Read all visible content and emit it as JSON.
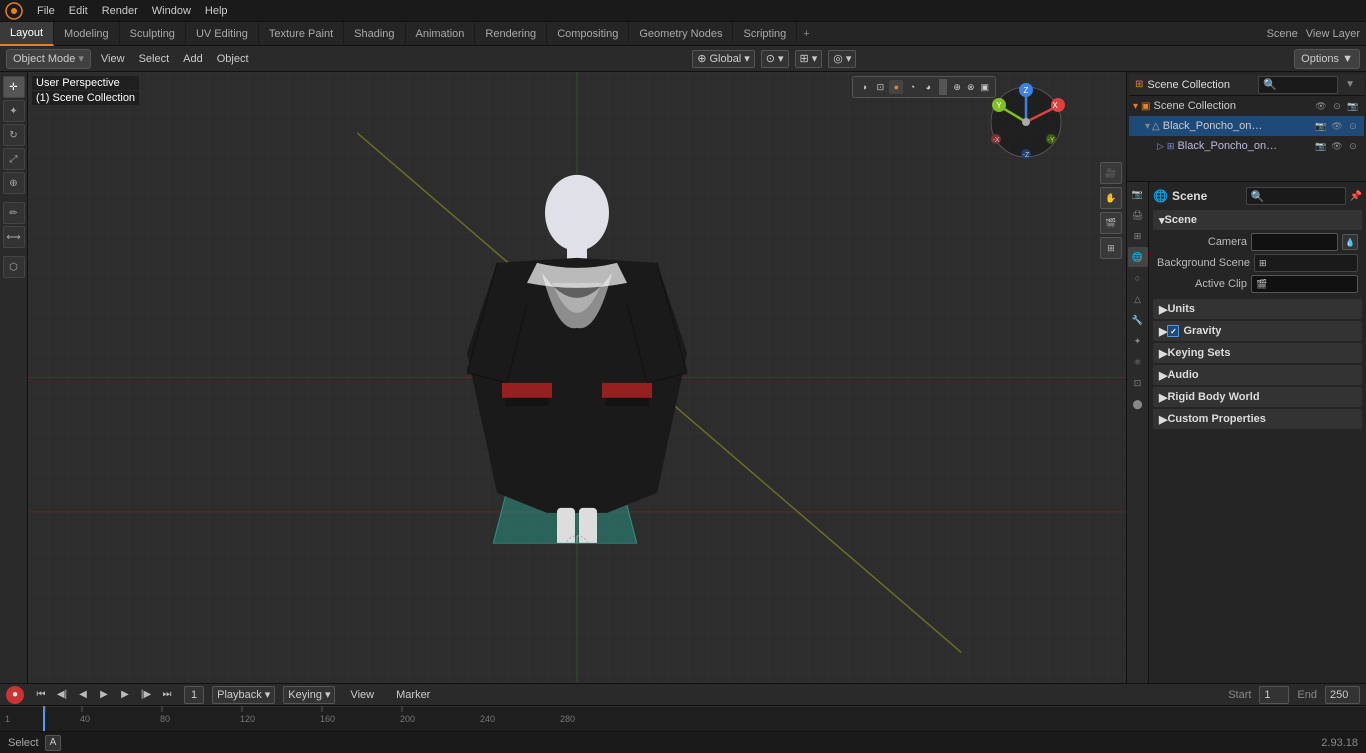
{
  "app": {
    "title": "Blender",
    "version": "2.93.18"
  },
  "menu": {
    "logo_symbol": "⬡",
    "items": [
      "File",
      "Edit",
      "Render",
      "Window",
      "Help"
    ]
  },
  "workspace_tabs": {
    "tabs": [
      "Layout",
      "Modeling",
      "Sculpting",
      "UV Editing",
      "Texture Paint",
      "Shading",
      "Animation",
      "Rendering",
      "Compositing",
      "Geometry Nodes",
      "Scripting"
    ],
    "active": "Layout",
    "add_symbol": "+"
  },
  "header": {
    "mode": "Object Mode",
    "view_label": "View",
    "select_label": "Select",
    "add_label": "Add",
    "object_label": "Object",
    "transform": "Global",
    "options_label": "Options ▼"
  },
  "viewport": {
    "view_type": "User Perspective",
    "scene_collection": "(1) Scene Collection"
  },
  "right_panel": {
    "header_title": "Scene Collection",
    "search_placeholder": "🔍",
    "filter_symbol": "▼"
  },
  "outliner": {
    "collection_label": "Scene Collection",
    "items": [
      {
        "name": "Black_Poncho_on_Mannequin",
        "indent": 1,
        "expanded": true,
        "icons": [
          "📷",
          "👁",
          "🔒"
        ]
      },
      {
        "name": "Black_Poncho_on_Manne",
        "indent": 2,
        "expanded": false,
        "icons": [
          "📷",
          "👁",
          "🔒"
        ]
      }
    ]
  },
  "properties": {
    "active_icon": "scene",
    "scene_label": "Scene",
    "subsection": "Scene",
    "camera_label": "Camera",
    "camera_value": "",
    "background_scene_label": "Background Scene",
    "active_clip_label": "Active Clip",
    "units_label": "Units",
    "gravity_label": "Gravity",
    "gravity_enabled": true,
    "keying_sets_label": "Keying Sets",
    "audio_label": "Audio",
    "rigid_body_world_label": "Rigid Body World",
    "custom_properties_label": "Custom Properties"
  },
  "timeline": {
    "playback_label": "Playback",
    "keying_label": "Keying",
    "view_label": "View",
    "marker_label": "Marker",
    "current_frame": "1",
    "start_label": "Start",
    "start_value": "1",
    "end_label": "End",
    "end_value": "250",
    "frame_markers": [
      "1",
      "40",
      "80",
      "120",
      "160",
      "200",
      "240",
      "280"
    ],
    "play_button": "▶",
    "jump_start": "⏮",
    "prev_frame": "◀",
    "next_frame": "▶",
    "jump_end": "⏭",
    "prev_keyframe": "◀|",
    "next_keyframe": "|▶",
    "record_symbol": "●"
  },
  "status_bar": {
    "select_label": "Select",
    "shortcut": "A",
    "version": "2.93.18"
  },
  "nav_gizmo": {
    "x_color": "#e04040",
    "y_color": "#80c020",
    "z_color": "#4080e0"
  },
  "tool_icons": {
    "cursor": "✛",
    "move": "✚",
    "rotate": "↻",
    "scale": "⤢",
    "transform": "⊕",
    "annotate": "✏",
    "measure": "📏",
    "add_obj": "⬡",
    "active_tool": "✛"
  }
}
